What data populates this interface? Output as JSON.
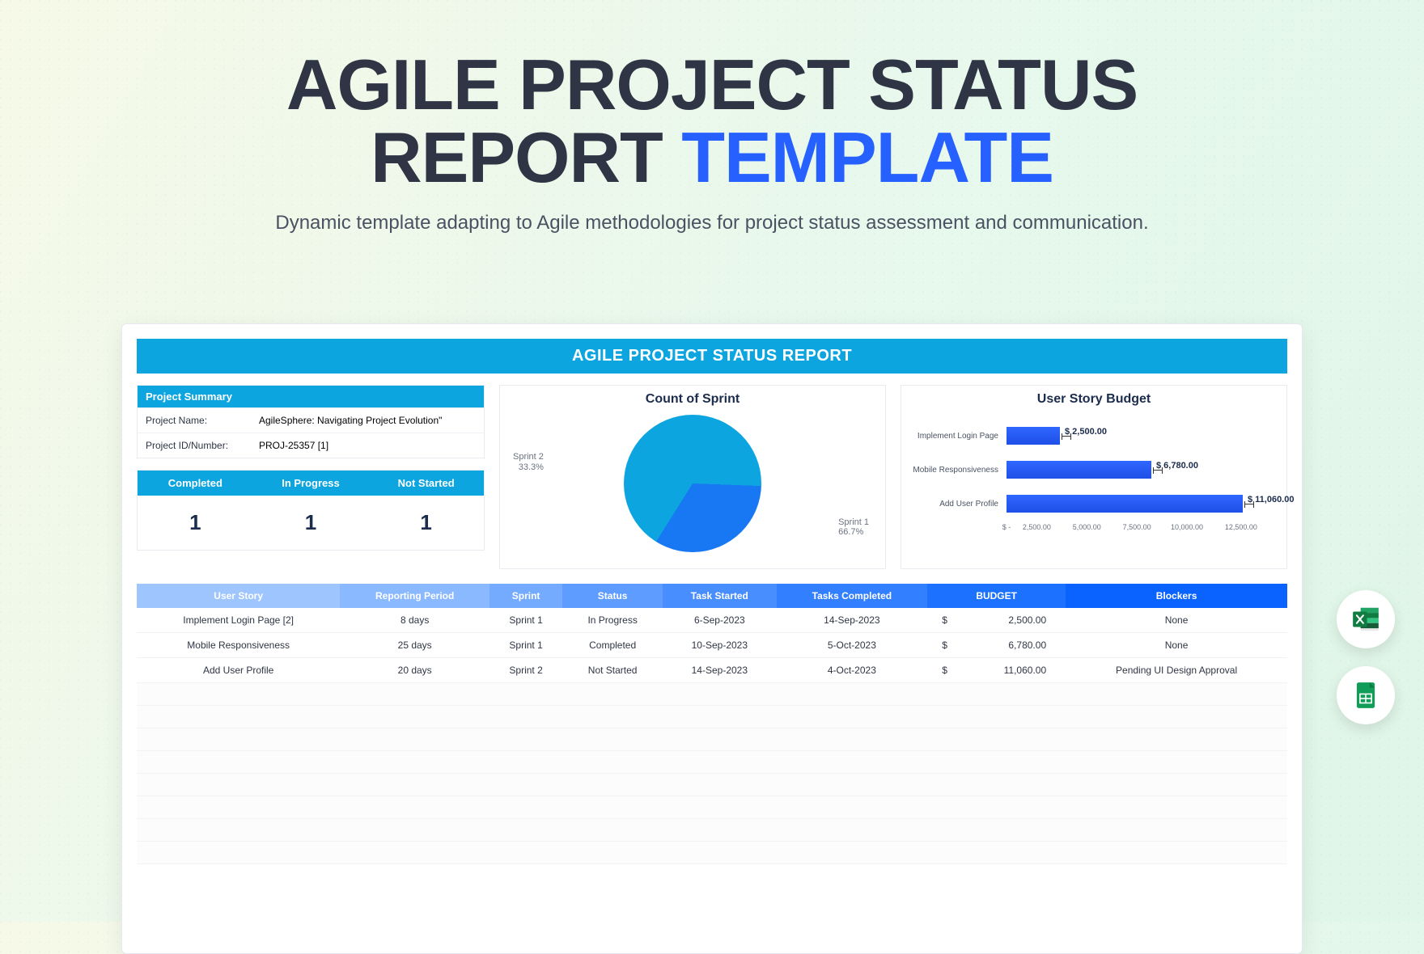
{
  "hero": {
    "title_lines": [
      "AGILE PROJECT STATUS",
      "REPORT "
    ],
    "title_accent": "TEMPLATE",
    "subtitle": "Dynamic template adapting to Agile methodologies for project status assessment and communication."
  },
  "sheet": {
    "banner": "AGILE PROJECT STATUS REPORT",
    "project_summary": {
      "header": "Project Summary",
      "rows": [
        {
          "label": "Project Name:",
          "value": "AgileSphere: Navigating Project Evolution\""
        },
        {
          "label": "Project ID/Number:",
          "value": "PROJ-25357 [1]"
        }
      ]
    },
    "status_boxes": {
      "labels": [
        "Completed",
        "In Progress",
        "Not Started"
      ],
      "values": [
        "1",
        "1",
        "1"
      ]
    },
    "pie_chart_title": "Count of Sprint",
    "bar_chart_title": "User Story Budget",
    "table": {
      "headers": [
        "User Story",
        "Reporting Period",
        "Sprint",
        "Status",
        "Task Started",
        "Tasks Completed",
        "BUDGET",
        "Blockers"
      ],
      "rows": [
        [
          "Implement Login Page [2]",
          "8 days",
          "Sprint 1",
          "In Progress",
          "6-Sep-2023",
          "14-Sep-2023",
          "2,500.00",
          "None"
        ],
        [
          "Mobile Responsiveness",
          "25 days",
          "Sprint 1",
          "Completed",
          "10-Sep-2023",
          "5-Oct-2023",
          "6,780.00",
          "None"
        ],
        [
          "Add User Profile",
          "20 days",
          "Sprint 2",
          "Not Started",
          "14-Sep-2023",
          "4-Oct-2023",
          "11,060.00",
          "Pending UI Design Approval"
        ]
      ]
    }
  },
  "chart_data": [
    {
      "type": "pie",
      "title": "Count of Sprint",
      "categories": [
        "Sprint 1",
        "Sprint 2"
      ],
      "values": [
        66.7,
        33.3
      ],
      "labels": [
        "Sprint 1 66.7%",
        "Sprint 2 33.3%"
      ]
    },
    {
      "type": "bar",
      "orientation": "horizontal",
      "title": "User Story Budget",
      "categories": [
        "Implement Login Page",
        "Mobile Responsiveness",
        "Add User Profile"
      ],
      "values": [
        2500,
        6780,
        11060
      ],
      "value_labels": [
        "$ 2,500.00",
        "$ 6,780.00",
        "$ 11,060.00"
      ],
      "xlabel": "",
      "ylabel": "",
      "xlim": [
        0,
        12500
      ],
      "x_ticks": [
        "$ -",
        "2,500.00",
        "5,000.00",
        "7,500.00",
        "10,000.00",
        "12,500.00"
      ]
    }
  ],
  "app_icons": [
    "excel-icon",
    "google-sheets-icon"
  ]
}
